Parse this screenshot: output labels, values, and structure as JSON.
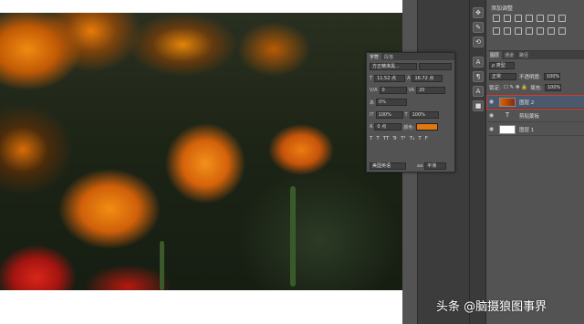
{
  "adjustments": {
    "title": "添加调整"
  },
  "layers_panel": {
    "tabs": [
      "图层",
      "通道",
      "路径"
    ],
    "kind_label": "ρ 类型",
    "blend_mode": "正常",
    "opacity_label": "不透明度:",
    "opacity_value": "100%",
    "lock_label": "锁定:",
    "fill_label": "填充:",
    "fill_value": "100%",
    "layers": [
      {
        "name": "图层 2",
        "selected": true
      },
      {
        "name": "剪贴蒙板",
        "selected": false
      },
      {
        "name": "图层 1",
        "selected": false
      }
    ]
  },
  "character_panel": {
    "tabs": [
      "字符",
      "段落"
    ],
    "font_family": "方正精准黑...",
    "font_size": "11.52 点",
    "leading": "16.72 点",
    "kerning": "0",
    "tracking": "20",
    "scale_percent": "0%",
    "vertical_scale": "100%",
    "horizontal_scale": "100%",
    "baseline_shift": "0 点",
    "color_label": "颜色:",
    "color_value": "#e07810",
    "glyph_buttons": [
      "T",
      "T",
      "TT",
      "Tr",
      "T¹",
      "T₁",
      "T",
      "F"
    ],
    "language": "美国英语",
    "antialias": "平滑"
  },
  "watermark": "头条 @脑摄狼图事界"
}
